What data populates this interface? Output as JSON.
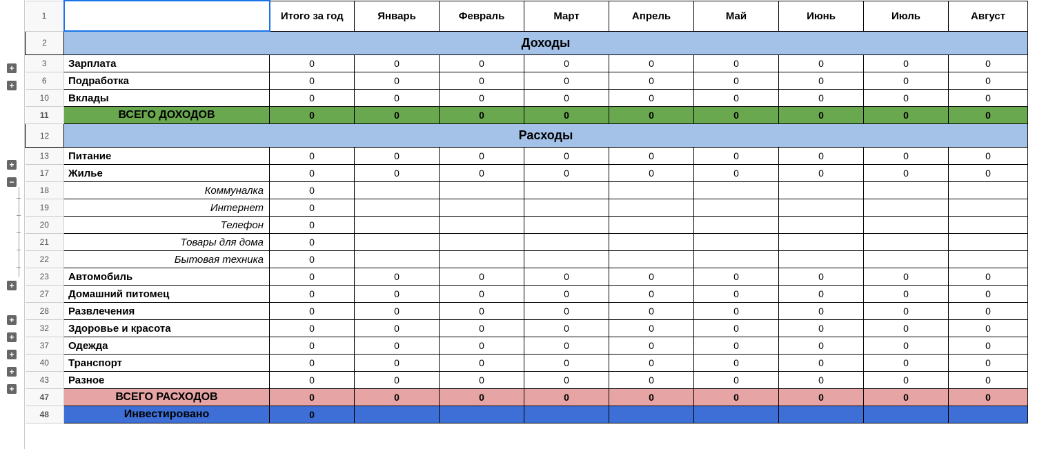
{
  "columns": [
    "Итого за год",
    "Январь",
    "Февраль",
    "Март",
    "Апрель",
    "Май",
    "Июнь",
    "Июль",
    "Август"
  ],
  "section_income": "Доходы",
  "section_expenses": "Расходы",
  "rows": {
    "salary": {
      "num": "3",
      "label": "Зарплата",
      "vals": [
        "0",
        "0",
        "0",
        "0",
        "0",
        "0",
        "0",
        "0",
        "0"
      ]
    },
    "sidejob": {
      "num": "6",
      "label": "Подработка",
      "vals": [
        "0",
        "0",
        "0",
        "0",
        "0",
        "0",
        "0",
        "0",
        "0"
      ]
    },
    "deposits": {
      "num": "10",
      "label": "Вклады",
      "vals": [
        "0",
        "0",
        "0",
        "0",
        "0",
        "0",
        "0",
        "0",
        "0"
      ]
    },
    "income_total": {
      "num": "11",
      "label": "ВСЕГО ДОХОДОВ",
      "vals": [
        "0",
        "0",
        "0",
        "0",
        "0",
        "0",
        "0",
        "0",
        "0"
      ]
    },
    "food": {
      "num": "13",
      "label": "Питание",
      "vals": [
        "0",
        "0",
        "0",
        "0",
        "0",
        "0",
        "0",
        "0",
        "0"
      ]
    },
    "housing": {
      "num": "17",
      "label": "Жилье",
      "vals": [
        "0",
        "0",
        "0",
        "0",
        "0",
        "0",
        "0",
        "0",
        "0"
      ]
    },
    "utilities": {
      "num": "18",
      "label": "Коммуналка",
      "vals": [
        "0",
        "",
        "",
        "",
        "",
        "",
        "",
        "",
        ""
      ]
    },
    "internet": {
      "num": "19",
      "label": "Интернет",
      "vals": [
        "0",
        "",
        "",
        "",
        "",
        "",
        "",
        "",
        ""
      ]
    },
    "phone": {
      "num": "20",
      "label": "Телефон",
      "vals": [
        "0",
        "",
        "",
        "",
        "",
        "",
        "",
        "",
        ""
      ]
    },
    "household": {
      "num": "21",
      "label": "Товары для дома",
      "vals": [
        "0",
        "",
        "",
        "",
        "",
        "",
        "",
        "",
        ""
      ]
    },
    "appliances": {
      "num": "22",
      "label": "Бытовая техника",
      "vals": [
        "0",
        "",
        "",
        "",
        "",
        "",
        "",
        "",
        ""
      ]
    },
    "car": {
      "num": "23",
      "label": "Автомобиль",
      "vals": [
        "0",
        "0",
        "0",
        "0",
        "0",
        "0",
        "0",
        "0",
        "0"
      ]
    },
    "pet": {
      "num": "27",
      "label": "Домашний питомец",
      "vals": [
        "0",
        "0",
        "0",
        "0",
        "0",
        "0",
        "0",
        "0",
        "0"
      ]
    },
    "entertain": {
      "num": "28",
      "label": "Развлечения",
      "vals": [
        "0",
        "0",
        "0",
        "0",
        "0",
        "0",
        "0",
        "0",
        "0"
      ]
    },
    "health": {
      "num": "32",
      "label": "Здоровье и красота",
      "vals": [
        "0",
        "0",
        "0",
        "0",
        "0",
        "0",
        "0",
        "0",
        "0"
      ]
    },
    "clothes": {
      "num": "37",
      "label": "Одежда",
      "vals": [
        "0",
        "0",
        "0",
        "0",
        "0",
        "0",
        "0",
        "0",
        "0"
      ]
    },
    "transport": {
      "num": "40",
      "label": "Транспорт",
      "vals": [
        "0",
        "0",
        "0",
        "0",
        "0",
        "0",
        "0",
        "0",
        "0"
      ]
    },
    "misc": {
      "num": "43",
      "label": "Разное",
      "vals": [
        "0",
        "0",
        "0",
        "0",
        "0",
        "0",
        "0",
        "0",
        "0"
      ]
    },
    "exp_total": {
      "num": "47",
      "label": "ВСЕГО РАСХОДОВ",
      "vals": [
        "0",
        "0",
        "0",
        "0",
        "0",
        "0",
        "0",
        "0",
        "0"
      ]
    },
    "invested": {
      "num": "48",
      "label": "Инвестировано",
      "vals": [
        "0",
        "",
        "",
        "",
        "",
        "",
        "",
        "",
        ""
      ]
    }
  },
  "header_row_num": "1",
  "section_income_num": "2",
  "section_expenses_num": "12"
}
